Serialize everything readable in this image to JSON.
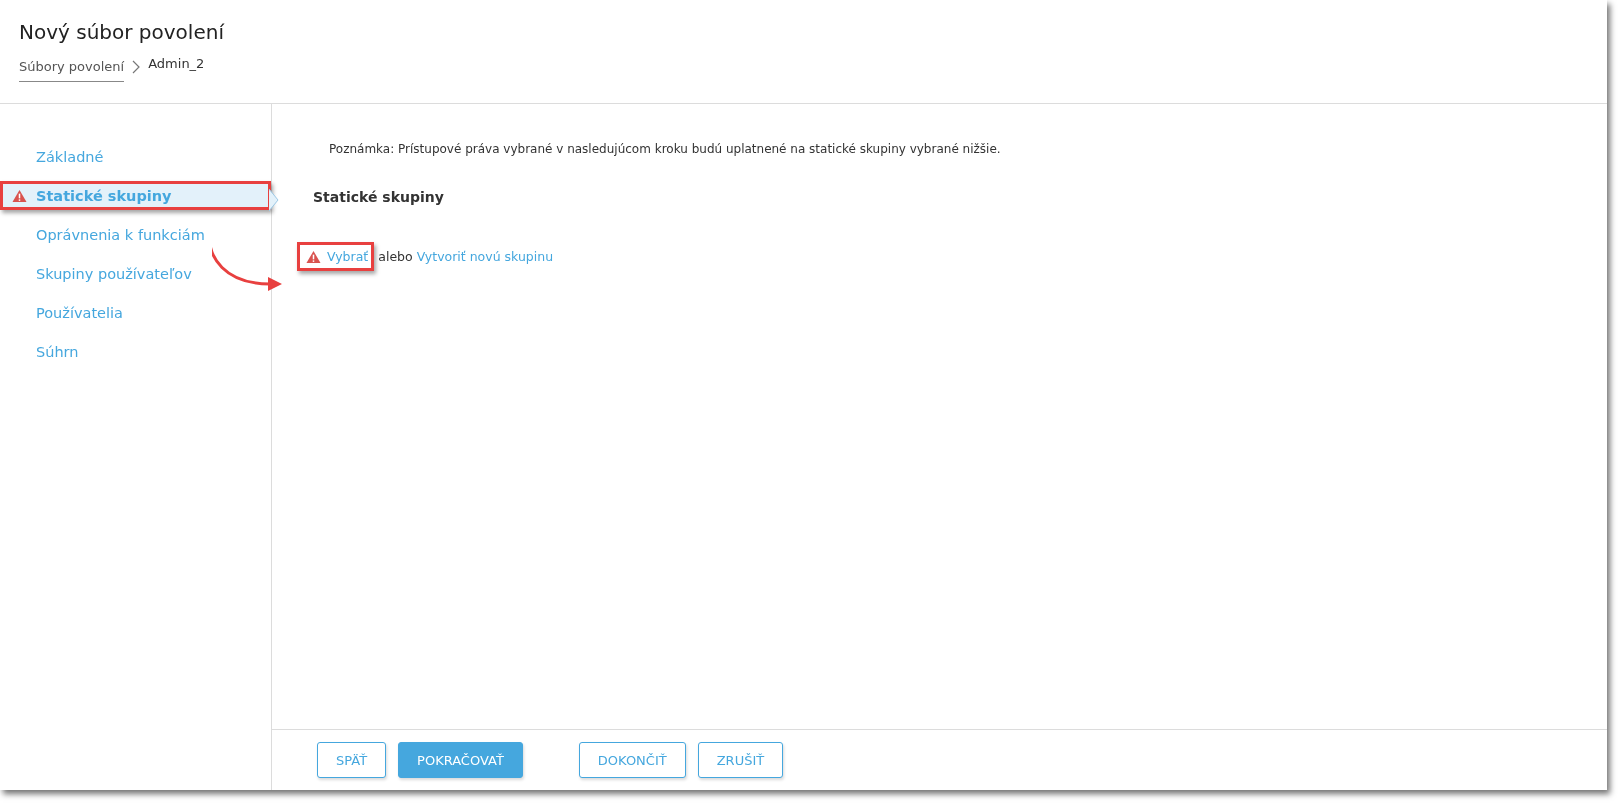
{
  "header": {
    "title": "Nový súbor povolení",
    "breadcrumb": [
      {
        "label": "Súbory povolení",
        "kind": "link"
      },
      {
        "label": "Admin_2",
        "kind": "current"
      }
    ]
  },
  "sidebar": {
    "items": [
      {
        "label": "Základné",
        "selected": false,
        "warning": false
      },
      {
        "label": "Statické skupiny",
        "selected": true,
        "warning": true
      },
      {
        "label": "Oprávnenia k funkciám",
        "selected": false,
        "warning": false
      },
      {
        "label": "Skupiny používateľov",
        "selected": false,
        "warning": false
      },
      {
        "label": "Používatelia",
        "selected": false,
        "warning": false
      },
      {
        "label": "Súhrn",
        "selected": false,
        "warning": false
      }
    ]
  },
  "content": {
    "note": "Poznámka: Prístupové práva vybrané v nasledujúcom kroku budú uplatnené na statické skupiny vybrané nižšie.",
    "section_title": "Statické skupiny",
    "warning": true,
    "select_link": "Vybrať",
    "conjunction": "alebo",
    "create_link": "Vytvoriť novú skupinu"
  },
  "footer": {
    "buttons": [
      {
        "label": "SPÄŤ",
        "kind": "secondary"
      },
      {
        "label": "POKRAČOVAŤ",
        "kind": "primary"
      },
      {
        "label": "DOKONČIŤ",
        "kind": "secondary"
      },
      {
        "label": "ZRUŠIŤ",
        "kind": "secondary"
      }
    ]
  }
}
